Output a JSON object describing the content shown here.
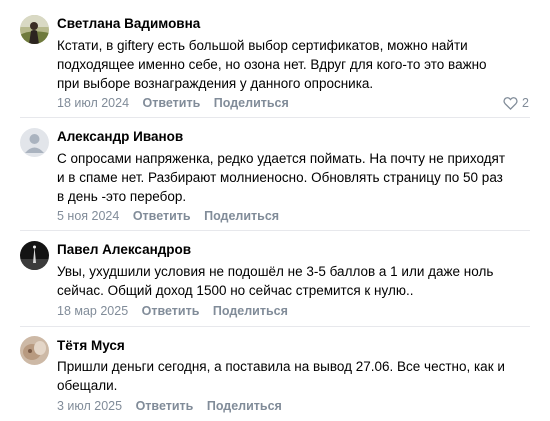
{
  "comments": [
    {
      "author": "Светлана Вадимовна",
      "avatar": "avatar-photo",
      "text_lines": [
        "Кстати, в giftery есть большой выбор сертификатов, можно найти",
        "подходящее именно себе, но озона нет. Вдруг для кого-то это важно",
        "при выборе вознаграждения у данного опросника."
      ],
      "date": "18 июл 2024",
      "reply_label": "Ответить",
      "share_label": "Поделиться",
      "likes": "2"
    },
    {
      "author": "Александр Иванов",
      "avatar": "default-avatar",
      "text_lines": [
        "С опросами напряженка, редко удается поймать. На почту не приходят",
        "и в спаме нет. Разбирают молниеносно. Обновлять страницу по 50 раз",
        "в день -это перебор."
      ],
      "date": "5 ноя 2024",
      "reply_label": "Ответить",
      "share_label": "Поделиться"
    },
    {
      "author": "Павел Александров",
      "avatar": "avatar-photo",
      "text_lines": [
        "Увы, ухудшили условия не подошёл не 3-5 баллов а 1 или даже ноль",
        "сейчас. Общий доход 1500 но сейчас стремится к нулю.."
      ],
      "date": "18 мар 2025",
      "reply_label": "Ответить",
      "share_label": "Поделиться"
    },
    {
      "author": "Тётя Муся",
      "avatar": "avatar-photo",
      "text_lines": [
        "Пришли деньги сегодня, а поставила на вывод 27.06. Все честно, как и",
        "обещали."
      ],
      "date": "3 июл 2025",
      "reply_label": "Ответить",
      "share_label": "Поделиться"
    }
  ],
  "colors": {
    "meta": "#818c99",
    "divider": "#e7e8ec",
    "text": "#000000"
  }
}
